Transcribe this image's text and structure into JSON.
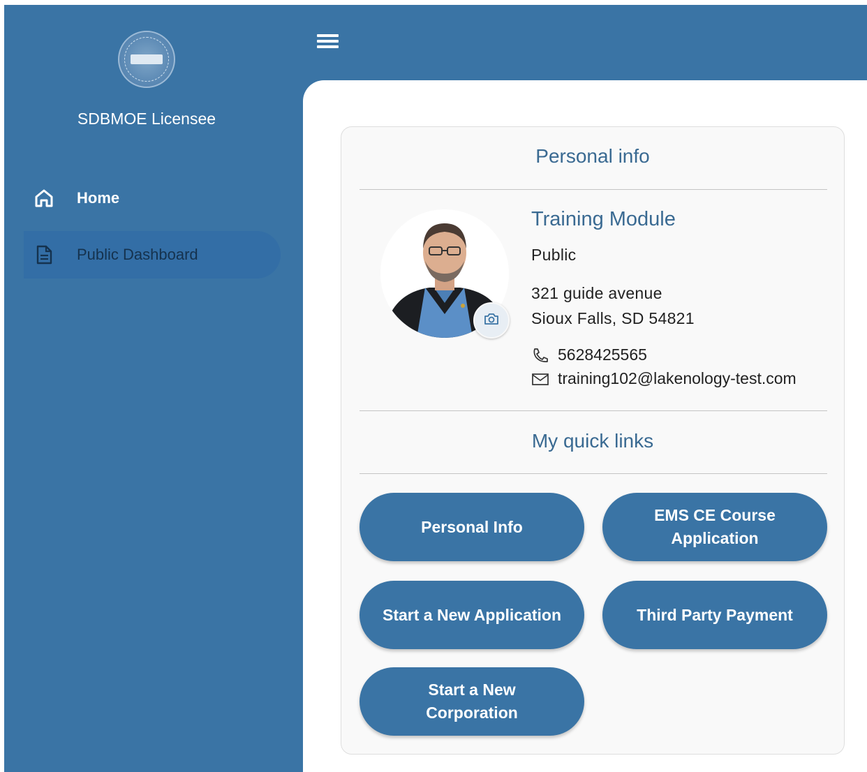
{
  "sidebar": {
    "app_name": "SDBMOE Licensee",
    "logo_icon": "state-seal-icon",
    "items": [
      {
        "label": "Home",
        "icon": "home-icon"
      },
      {
        "label": "Public Dashboard",
        "icon": "document-icon"
      }
    ]
  },
  "topbar": {
    "menu_icon": "hamburger-menu-icon"
  },
  "personal": {
    "title": "Personal info",
    "name": "Training Module",
    "role": "Public",
    "address_line1": "321 guide avenue",
    "address_line2": "Sioux Falls, SD 54821",
    "phone": "5628425565",
    "email": "training102@lakenology-test.com"
  },
  "quick_links": {
    "title": "My quick links",
    "buttons": [
      {
        "label": "Personal Info"
      },
      {
        "label": "EMS CE Course Application"
      },
      {
        "label": "Start a New Application"
      },
      {
        "label": "Third Party Payment"
      },
      {
        "label": "Start a New Corporation"
      }
    ]
  },
  "colors": {
    "brand": "#3a74a5",
    "heading": "#3a6a92",
    "active_nav": "#336ea6"
  }
}
